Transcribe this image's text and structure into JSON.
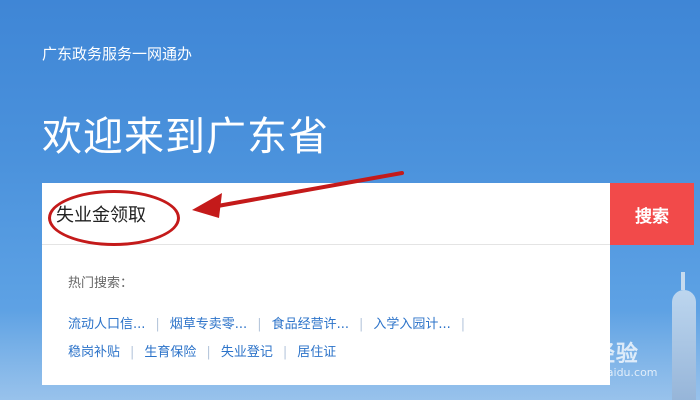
{
  "header": {
    "portal_name": "广东政务服务一网通办"
  },
  "hero": {
    "title": "欢迎来到广东省"
  },
  "search": {
    "value": "失业金领取",
    "button_label": "搜索",
    "hot_label": "热门搜索："
  },
  "hot_searches": {
    "row1": [
      "流动人口信...",
      "烟草专卖零...",
      "食品经营许...",
      "入学入园计..."
    ],
    "row2": [
      "稳岗补贴",
      "生育保险",
      "失业登记",
      "居住证"
    ]
  },
  "watermark": {
    "text": "Bai 经验",
    "url": "jingyan.baidu.com"
  },
  "colors": {
    "accent_red": "#f24a4a",
    "link_blue": "#2c73c9",
    "annotation_red": "#c41a1a"
  }
}
